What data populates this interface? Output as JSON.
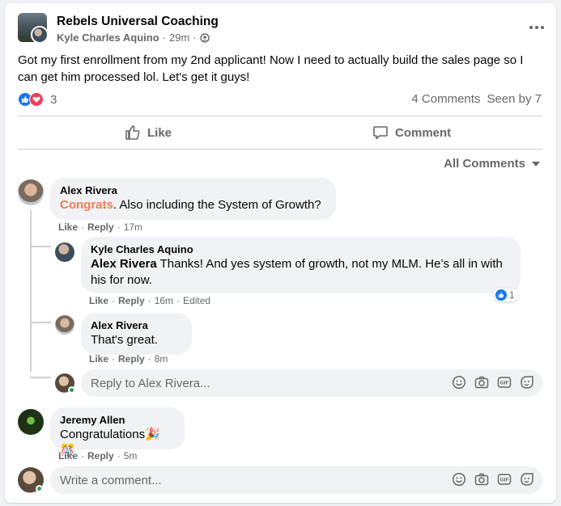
{
  "post": {
    "group_name": "Rebels Universal Coaching",
    "author": "Kyle Charles Aquino",
    "time": "29m",
    "separator": "·",
    "text": "Got my first enrollment from my 2nd applicant!  Now I need to actually build the sales page so I can get him processed lol.  Let's get it guys!",
    "reaction_count": "3",
    "comments_count": "4 Comments",
    "seen_by": "Seen by 7"
  },
  "actions": {
    "like_label": "Like",
    "comment_label": "Comment"
  },
  "filter": {
    "label": "All Comments"
  },
  "comments": [
    {
      "name": "Alex Rivera",
      "highlight": "Congrats",
      "text": ". Also including the System of Growth?",
      "like": "Like",
      "reply": "Reply",
      "time": "17m"
    },
    {
      "name": "Kyle Charles Aquino",
      "mention": "Alex Rivera",
      "text": " Thanks! And yes system of growth, not my MLM. He’s all in with his for now.",
      "like": "Like",
      "reply": "Reply",
      "time": "16m",
      "edited": "Edited",
      "like_count": "1"
    },
    {
      "name": "Alex Rivera",
      "text": "That's great.",
      "like": "Like",
      "reply": "Reply",
      "time": "8m"
    },
    {
      "name": "Jeremy Allen",
      "text": "Congratulations🎉🎊",
      "like": "Like",
      "reply": "Reply",
      "time": "5m"
    }
  ],
  "reply_input": {
    "placeholder": "Reply to Alex Rivera..."
  },
  "comment_input": {
    "placeholder": "Write a comment..."
  },
  "colors": {
    "brand_blue": "#1877f2",
    "love_red": "#f33e58",
    "highlight_orange": "#f27a52",
    "online_green": "#31a24c"
  }
}
